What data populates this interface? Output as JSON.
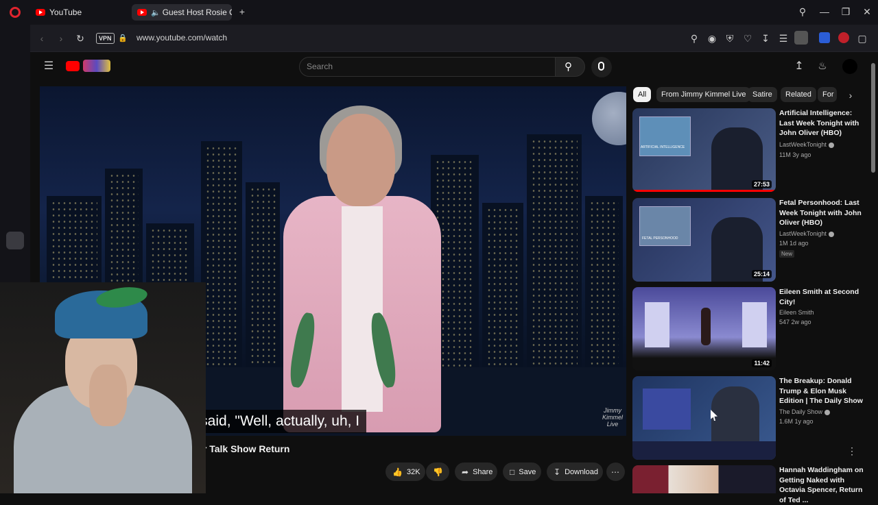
{
  "browser": {
    "tabs": [
      {
        "label": "YouTube"
      },
      {
        "label": "Guest Host Rosie O'Do"
      }
    ],
    "url": "www.youtube.com/watch",
    "vpn_label": "VPN"
  },
  "youtube": {
    "search": {
      "placeholder": "Search"
    },
    "video": {
      "subtitle": "o I said, \"Well, actually, uh, I",
      "title": "Her Talk Show Return",
      "watermark": "Jimmy Kimmel Live"
    },
    "actions": {
      "likes": "32K",
      "share": "Share",
      "save": "Save",
      "download": "Download"
    },
    "chips": [
      "All",
      "From Jimmy Kimmel Live",
      "Satire",
      "Related",
      "For"
    ],
    "recommendations": [
      {
        "title": "Artificial Intelligence: Last Week Tonight with John Oliver (HBO)",
        "channel": "LastWeekTonight",
        "meta": "11M  3y ago",
        "duration": "27:53",
        "thumb_text": "ARTIFICIAL INTELLIGENCE",
        "colors": [
          "#27365a",
          "#4a5c86"
        ]
      },
      {
        "title": "Fetal Personhood: Last Week Tonight with John Oliver (HBO)",
        "channel": "LastWeekTonight",
        "meta": "1M  1d ago",
        "duration": "25:14",
        "badge": "New",
        "thumb_text": "FETAL PERSONHOOD",
        "colors": [
          "#25325a",
          "#44568a"
        ]
      },
      {
        "title": "Eileen Smith at Second City!",
        "channel": "Eileen Smith",
        "meta": "547  2w ago",
        "duration": "11:42",
        "colors": [
          "#4b4a9a",
          "#8a8ad0"
        ]
      },
      {
        "title": "The Breakup: Donald Trump & Elon Musk Edition | The Daily Show",
        "channel": "The Daily Show",
        "meta": "1.6M  1y ago",
        "colors": [
          "#1f3460",
          "#3a5a90"
        ]
      },
      {
        "title": "Hannah Waddingham on Getting Naked with Octavia Spencer, Return of Ted ...",
        "colors": [
          "#7a2030",
          "#d8b8a0"
        ]
      }
    ]
  }
}
